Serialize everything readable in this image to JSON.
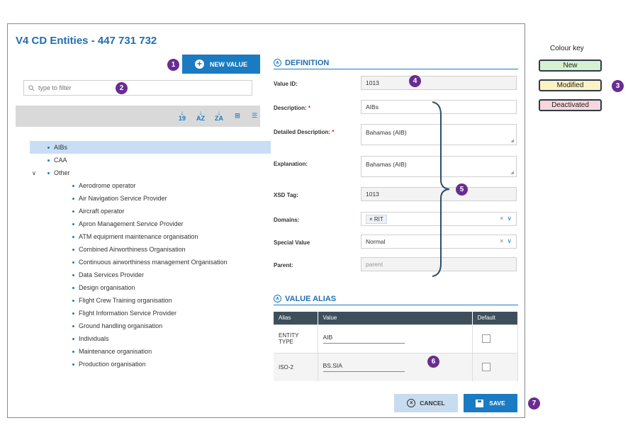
{
  "dialog": {
    "title": "V4 CD Entities - 447 731 732",
    "new_value_label": "NEW VALUE",
    "filter_placeholder": "type to filter",
    "tree": [
      {
        "label": "AIBs",
        "level": 0,
        "selected": true
      },
      {
        "label": "CAA",
        "level": 0
      },
      {
        "label": "Other",
        "level": 0,
        "expanded": true
      },
      {
        "label": "Aerodrome operator",
        "level": 1
      },
      {
        "label": "Air Navigation Service Provider",
        "level": 1
      },
      {
        "label": "Aircraft operator",
        "level": 1
      },
      {
        "label": "Apron Management Service Provider",
        "level": 1
      },
      {
        "label": "ATM equipment maintenance organisation",
        "level": 1
      },
      {
        "label": "Combined Airworthiness Organisation",
        "level": 1
      },
      {
        "label": "Continuous airworthiness management Organisation",
        "level": 1
      },
      {
        "label": "Data Services Provider",
        "level": 1
      },
      {
        "label": "Design organisation",
        "level": 1
      },
      {
        "label": "Flight Crew Training organisation",
        "level": 1
      },
      {
        "label": "Flight Information Service Provider",
        "level": 1
      },
      {
        "label": "Ground handling organisation",
        "level": 1
      },
      {
        "label": "Individuals",
        "level": 1
      },
      {
        "label": "Maintenance organisation",
        "level": 1
      },
      {
        "label": "Production organisation",
        "level": 1
      }
    ],
    "definition": {
      "heading": "DEFINITION",
      "value_id_label": "Value ID:",
      "value_id": "1013",
      "description_label": "Description:",
      "description": "AIBs",
      "detailed_label": "Detailed Description:",
      "detailed": "Bahamas (AIB)",
      "explanation_label": "Explanation:",
      "explanation": "Bahamas (AIB)",
      "xsd_label": "XSD Tag:",
      "xsd": "1013",
      "domains_label": "Domains:",
      "domain_tag": "RIT",
      "special_label": "Special Value",
      "special": "Normal",
      "parent_label": "Parent:",
      "parent_placeholder": "parent",
      "required_mark": "*"
    },
    "value_alias": {
      "heading": "VALUE ALIAS",
      "columns": [
        "Alias",
        "Value",
        "Default"
      ],
      "rows": [
        {
          "alias": "ENTITY TYPE",
          "value": "AIB",
          "default": false
        },
        {
          "alias": "ISO-2",
          "value": "BS.SIA",
          "default": false
        }
      ]
    },
    "cancel_label": "CANCEL",
    "save_label": "SAVE"
  },
  "badges": [
    "1",
    "2",
    "3",
    "4",
    "5",
    "6",
    "7"
  ],
  "colour_key": {
    "title": "Colour key",
    "items": [
      {
        "label": "New",
        "color": "#d7f0cf"
      },
      {
        "label": "Modified",
        "color": "#fdf2c4"
      },
      {
        "label": "Deactivated",
        "color": "#f8d7da"
      }
    ]
  },
  "colors": {
    "accent": "#1a7bc2",
    "badge": "#6a2c91",
    "header_row": "#3e4f5c"
  }
}
